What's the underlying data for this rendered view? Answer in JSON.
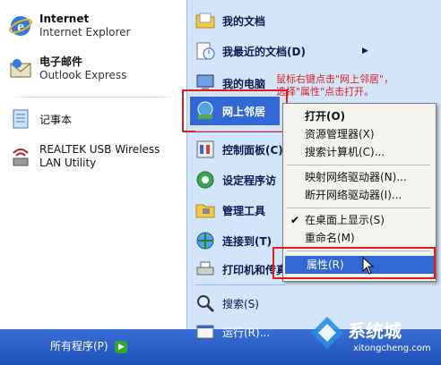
{
  "left_pane": {
    "pinned": [
      {
        "title": "Internet",
        "subtitle": "Internet Explorer",
        "icon": "internet-explorer-icon"
      },
      {
        "title": "电子邮件",
        "subtitle": "Outlook Express",
        "icon": "outlook-express-icon"
      }
    ],
    "recent": [
      {
        "label": "记事本",
        "icon": "notepad-icon"
      },
      {
        "label": "REALTEK USB Wireless LAN Utility",
        "icon": "wireless-utility-icon"
      }
    ],
    "all_programs": "所有程序(P)"
  },
  "right_pane": {
    "items": [
      {
        "label": "我的文档",
        "icon": "my-documents-icon"
      },
      {
        "label": "我最近的文档(D)",
        "icon": "recent-documents-icon"
      },
      {
        "label": "我的电脑",
        "icon": "my-computer-icon"
      },
      {
        "label": "网上邻居",
        "icon": "network-places-icon"
      },
      {
        "label": "控制面板(C)",
        "icon": "control-panel-icon"
      },
      {
        "label": "设定程序访",
        "icon": "program-access-icon"
      },
      {
        "label": "管理工具",
        "icon": "admin-tools-icon"
      },
      {
        "label": "连接到(T)",
        "icon": "connect-to-icon"
      },
      {
        "label": "打印机和传真",
        "icon": "printers-faxes-icon"
      },
      {
        "label": "搜索(S)",
        "icon": "search-icon"
      },
      {
        "label": "运行(R)...",
        "icon": "run-icon"
      }
    ]
  },
  "context_menu": {
    "items": [
      "打开(O)",
      "资源管理器(X)",
      "搜索计算机(C)...",
      "映射网络驱动器(N)...",
      "断开网络驱动器(I)...",
      "在桌面上显示(S)",
      "重命名(M)",
      "属性(R)"
    ]
  },
  "annotation": {
    "line1": "鼠标右键点击\"网上邻居\"，",
    "line2": "选择\"属性\"点击打开。"
  },
  "watermark": {
    "brand": "系统城",
    "url": "xitongcheng.com"
  },
  "colors": {
    "annotation_red": "#e21b1b",
    "xp_blue": "#1f4fb8",
    "selection_blue": "#3168d5"
  }
}
